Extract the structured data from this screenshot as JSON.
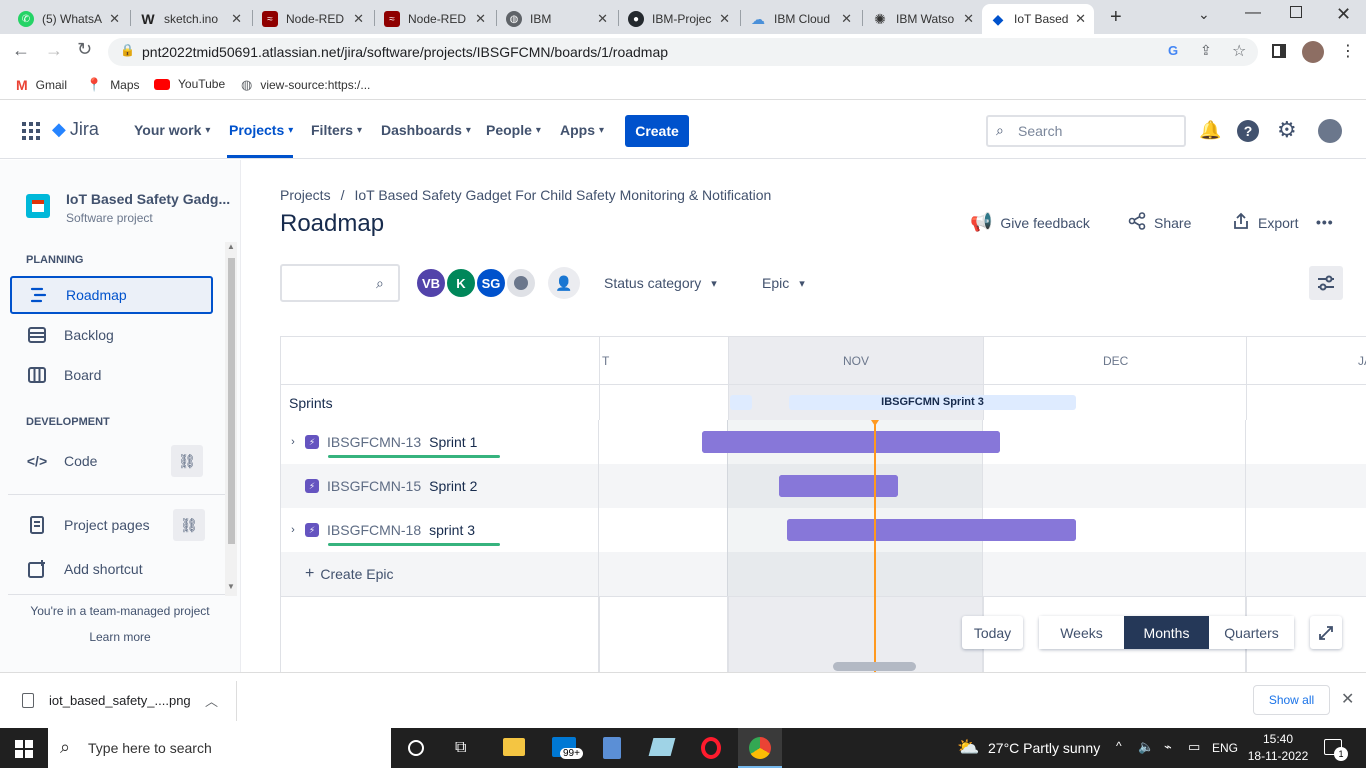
{
  "browser": {
    "tabs": [
      {
        "title": "(5) WhatsA",
        "icon": "whatsapp-icon",
        "color": "#25d366"
      },
      {
        "title": "sketch.ino",
        "icon": "wokwi-icon",
        "color": "#222222"
      },
      {
        "title": "Node-RED",
        "icon": "node-red-icon",
        "color": "#8f0000"
      },
      {
        "title": "Node-RED",
        "icon": "node-red-icon",
        "color": "#8f0000"
      },
      {
        "title": "IBM",
        "icon": "globe-icon",
        "color": "#5f6368"
      },
      {
        "title": "IBM-Projec",
        "icon": "github-icon",
        "color": "#24292e"
      },
      {
        "title": "IBM Cloud",
        "icon": "cloud-icon",
        "color": "#4a90d9"
      },
      {
        "title": "IBM Watso",
        "icon": "watson-icon",
        "color": "#333333"
      },
      {
        "title": "IoT Based",
        "icon": "jira-icon",
        "color": "#0052cc"
      }
    ],
    "url": "pnt2022tmid50691.atlassian.net/jira/software/projects/IBSGFCMN/boards/1/roadmap",
    "bookmarks": [
      {
        "label": "Gmail",
        "icon": "gmail-icon"
      },
      {
        "label": "Maps",
        "icon": "maps-icon"
      },
      {
        "label": "YouTube",
        "icon": "youtube-icon"
      },
      {
        "label": "view-source:https:/...",
        "icon": "globe-icon"
      }
    ]
  },
  "topnav": {
    "product": "Jira",
    "items": [
      "Your work",
      "Projects",
      "Filters",
      "Dashboards",
      "People",
      "Apps"
    ],
    "create": "Create",
    "search_placeholder": "Search"
  },
  "sidebar": {
    "project_name": "IoT Based Safety Gadg...",
    "project_type": "Software project",
    "planning_heading": "PLANNING",
    "planning_items": [
      "Roadmap",
      "Backlog",
      "Board"
    ],
    "development_heading": "DEVELOPMENT",
    "code": "Code",
    "project_pages": "Project pages",
    "add_shortcut": "Add shortcut",
    "team_managed": "You're in a team-managed project",
    "learn_more": "Learn more"
  },
  "main": {
    "breadcrumb_projects": "Projects",
    "breadcrumb_sep": "/",
    "breadcrumb_project": "IoT Based Safety Gadget For Child Safety Monitoring & Notification",
    "title": "Roadmap",
    "give_feedback": "Give feedback",
    "share": "Share",
    "export": "Export",
    "more": "•••",
    "avatars": [
      {
        "initials": "VB",
        "color": "#5243aa"
      },
      {
        "initials": "K",
        "color": "#00875a"
      },
      {
        "initials": "SG",
        "color": "#0052cc"
      }
    ],
    "status_category": "Status category",
    "epic_filter": "Epic",
    "months": [
      "T",
      "NOV",
      "DEC",
      "JA"
    ],
    "sprints_label": "Sprints",
    "sprint_bar": "IBSGFCMN Sprint 3",
    "epics": [
      {
        "key": "IBSGFCMN-13",
        "name": "Sprint 1",
        "expandable": true,
        "progress": 1.0
      },
      {
        "key": "IBSGFCMN-15",
        "name": "Sprint 2",
        "expandable": false,
        "progress": 0
      },
      {
        "key": "IBSGFCMN-18",
        "name": "sprint 3",
        "expandable": true,
        "progress": 1.0
      }
    ],
    "create_epic": "Create Epic",
    "today": "Today",
    "zoom": [
      "Weeks",
      "Months",
      "Quarters"
    ],
    "zoom_selected": "Months"
  },
  "downloads": {
    "file": "iot_based_safety_....png",
    "show_all": "Show all"
  },
  "taskbar": {
    "search": "Type here to search",
    "weather": "27°C  Partly sunny",
    "lang": "ENG",
    "time": "15:40",
    "date": "18-11-2022",
    "mail_badge": "99+",
    "notif_badge": "1"
  },
  "colors": {
    "accent": "#0052cc",
    "epic": "#8777d9",
    "today_line": "#ff991f",
    "progress": "#36b37e"
  }
}
